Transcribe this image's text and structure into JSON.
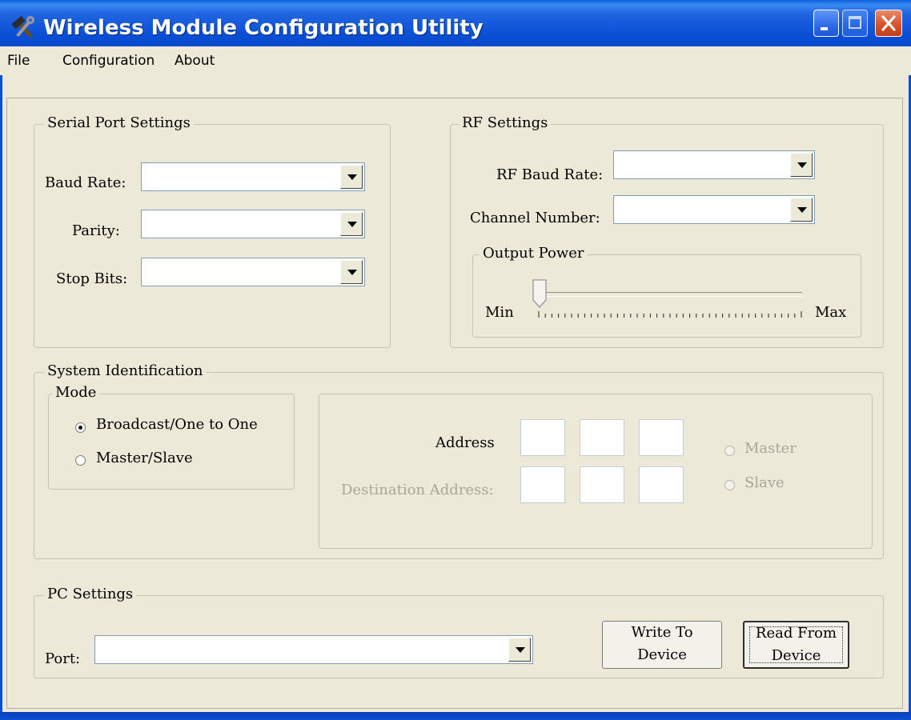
{
  "window": {
    "title": "Wireless Module Configuration Utility"
  },
  "menu": {
    "items": [
      "File",
      "Configuration",
      "About"
    ]
  },
  "serial": {
    "legend": "Serial Port Settings",
    "baud_label": "Baud Rate:",
    "parity_label": "Parity:",
    "stop_label": "Stop Bits:",
    "baud_value": "",
    "parity_value": "",
    "stop_value": ""
  },
  "rf": {
    "legend": "RF Settings",
    "baud_label": "RF Baud Rate:",
    "channel_label": "Channel Number:",
    "baud_value": "",
    "channel_value": "",
    "power": {
      "legend": "Output Power",
      "min_label": "Min",
      "max_label": "Max",
      "level": 0.0
    }
  },
  "sysid": {
    "legend": "System Identification",
    "mode": {
      "legend": "Mode",
      "options": [
        {
          "label": "Broadcast/One to One",
          "checked": true
        },
        {
          "label": "Master/Slave",
          "checked": false
        }
      ]
    },
    "address_label": "Address",
    "dest_label": "Destination Address:",
    "role_options": [
      {
        "label": "Master",
        "enabled": false
      },
      {
        "label": "Slave",
        "enabled": false
      }
    ]
  },
  "pc": {
    "legend": "PC Settings",
    "port_label": "Port:",
    "port_value": "",
    "write_button": [
      "Write To",
      "Device"
    ],
    "read_button": [
      "Read From",
      "Device"
    ]
  },
  "colors": {
    "titlebar": "#0b4fd6",
    "face": "#ece9d8",
    "close": "#d8532d"
  },
  "icons": {
    "app": "hammer-wrench-icon",
    "minimize": "minimize-icon",
    "maximize": "maximize-icon",
    "close": "close-icon"
  }
}
